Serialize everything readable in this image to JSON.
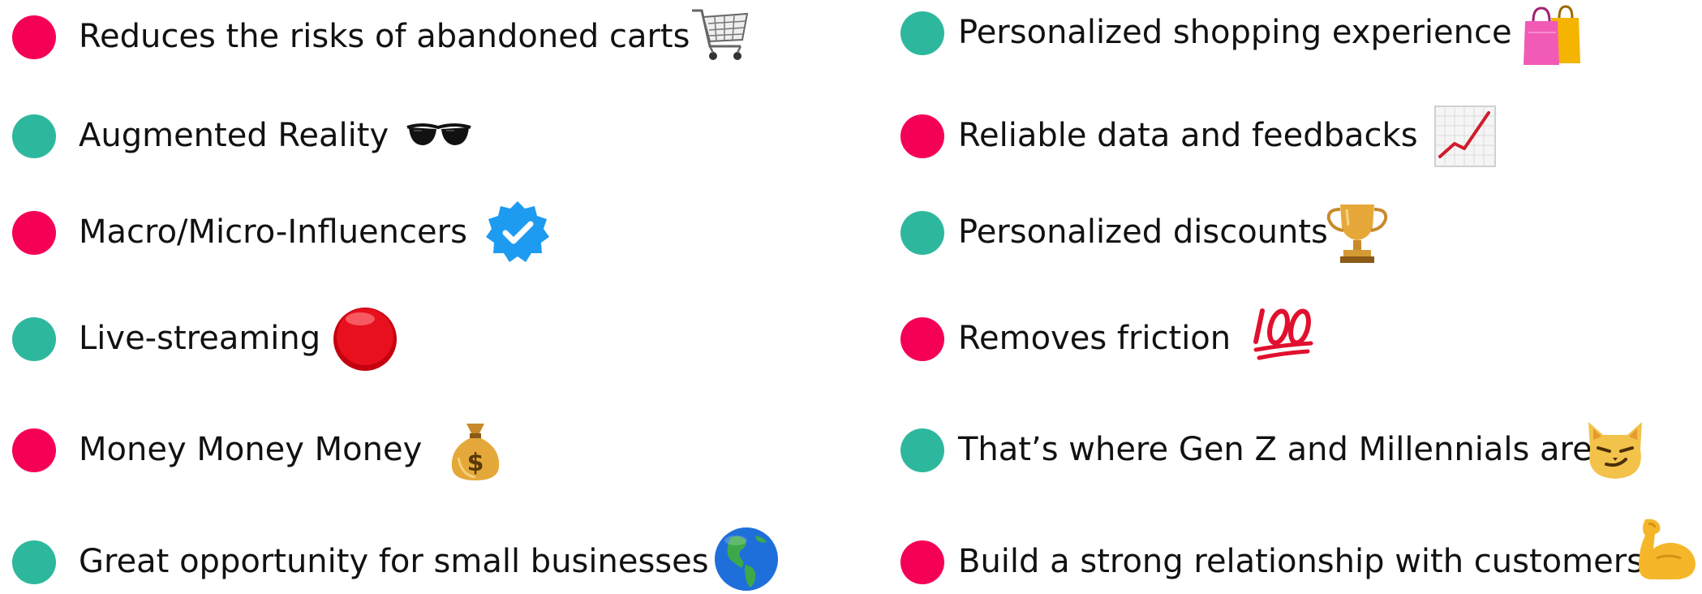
{
  "colors": {
    "accent_pink": "#F50057",
    "accent_teal": "#2DB89D",
    "text": "#111111",
    "background": "#FFFFFF"
  },
  "left_items": [
    {
      "label": "Reduces the risks of abandoned carts",
      "dot_color": "pink",
      "icon": "shopping-cart-icon"
    },
    {
      "label": "Augmented Reality",
      "dot_color": "teal",
      "icon": "sunglasses-icon"
    },
    {
      "label": "Macro/Micro-Influencers",
      "dot_color": "pink",
      "icon": "verified-badge-icon"
    },
    {
      "label": "Live-streaming",
      "dot_color": "teal",
      "icon": "red-circle-icon"
    },
    {
      "label": "Money Money Money",
      "dot_color": "pink",
      "icon": "money-bag-icon"
    },
    {
      "label": "Great opportunity for small businesses",
      "dot_color": "teal",
      "icon": "globe-americas-icon"
    }
  ],
  "right_items": [
    {
      "label": "Personalized shopping experience",
      "dot_color": "teal",
      "icon": "shopping-bags-icon"
    },
    {
      "label": "Reliable data and feedbacks",
      "dot_color": "pink",
      "icon": "chart-increasing-icon"
    },
    {
      "label": "Personalized discounts",
      "dot_color": "teal",
      "icon": "trophy-icon"
    },
    {
      "label": "Removes friction",
      "dot_color": "pink",
      "icon": "hundred-points-icon"
    },
    {
      "label": "That’s where Gen Z and Millennials are",
      "dot_color": "teal",
      "icon": "smirking-cat-icon"
    },
    {
      "label": "Build a strong relationship with customers",
      "dot_color": "pink",
      "icon": "flexed-biceps-icon"
    }
  ]
}
